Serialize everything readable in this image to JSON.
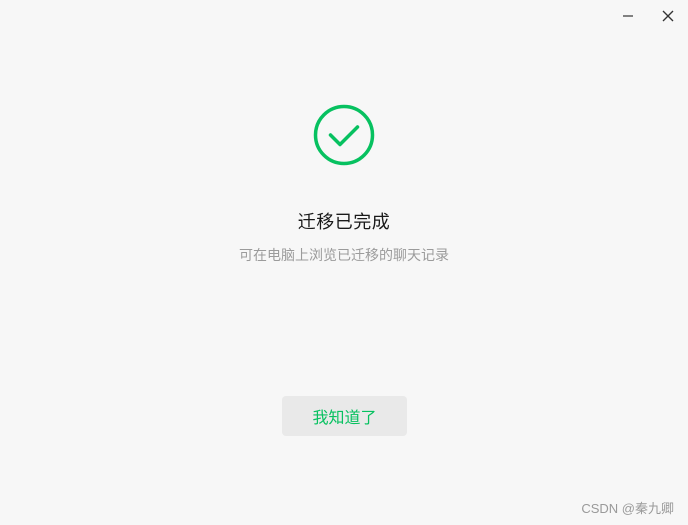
{
  "window": {
    "controls": {
      "minimize_icon": "minimize-icon",
      "close_icon": "close-icon"
    }
  },
  "main": {
    "status_icon": "check-circle-icon",
    "title": "迁移已完成",
    "subtitle": "可在电脑上浏览已迁移的聊天记录",
    "confirm_button_label": "我知道了"
  },
  "watermark": "CSDN @秦九卿",
  "colors": {
    "accent": "#07c160",
    "background": "#f7f7f7",
    "button_bg": "#e9e9e9",
    "title_text": "#1a1a1a",
    "subtitle_text": "#9b9b9b"
  }
}
